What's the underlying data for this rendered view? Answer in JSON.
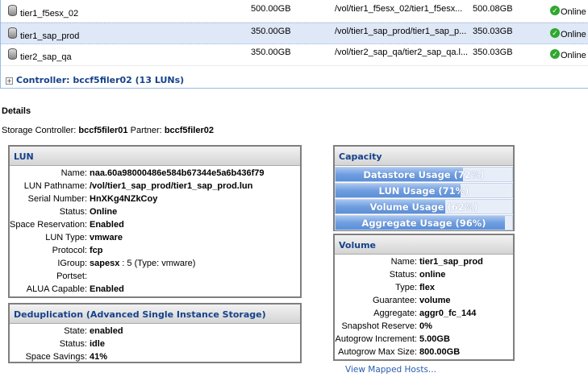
{
  "luns": [
    {
      "name": "tier1_f5esx_02",
      "size": "500.00GB",
      "path": "/vol/tier1_f5esx_02/tier1_f5esx...",
      "alloc": "500.08GB",
      "status": "Online"
    },
    {
      "name": "tier1_sap_prod",
      "size": "350.00GB",
      "path": "/vol/tier1_sap_prod/tier1_sap_p...",
      "alloc": "350.03GB",
      "status": "Online"
    },
    {
      "name": "tier2_sap_qa",
      "size": "350.00GB",
      "path": "/vol/tier2_sap_qa/tier2_sap_qa.l...",
      "alloc": "350.03GB",
      "status": "Online"
    }
  ],
  "controller_group": "Controller: bccf5filer02 (13 LUNs)",
  "details_title": "Details",
  "storage": {
    "label": "Storage Controller:",
    "controller": "bccf5filer01",
    "partner_label": "Partner:",
    "partner": "bccf5filer02"
  },
  "lun_panel": {
    "title": "LUN",
    "fields": [
      {
        "k": "Name:",
        "v": "naa.60a98000486e584b67344e5a6b436f79"
      },
      {
        "k": "LUN Pathname:",
        "v": "/vol/tier1_sap_prod/tier1_sap_prod.lun"
      },
      {
        "k": "Serial Number:",
        "v": "HnXKg4NZkCoy"
      },
      {
        "k": "Status:",
        "v": "Online"
      },
      {
        "k": "Space Reservation:",
        "v": "Enabled"
      },
      {
        "k": "LUN Type:",
        "v": "vmware"
      },
      {
        "k": "Protocol:",
        "v": "fcp"
      },
      {
        "k": "IGroup:",
        "v": "sapesx",
        "v2": ": 5 (Type: vmware)"
      },
      {
        "k": "Portset:",
        "v": ""
      },
      {
        "k": "ALUA Capable:",
        "v": "Enabled"
      }
    ]
  },
  "dedup_panel": {
    "title": "Deduplication (Advanced Single Instance Storage)",
    "fields": [
      {
        "k": "State:",
        "v": "enabled"
      },
      {
        "k": "Status:",
        "v": "idle"
      },
      {
        "k": "Space Savings:",
        "v": "41%"
      }
    ]
  },
  "capacity_panel": {
    "title": "Capacity",
    "bars": [
      {
        "label": "Datastore Usage (72%)",
        "percent": 72
      },
      {
        "label": "LUN Usage (71%)",
        "percent": 71
      },
      {
        "label": "Volume Usage (62%)",
        "percent": 62
      },
      {
        "label": "Aggregate Usage (96%)",
        "percent": 96
      }
    ]
  },
  "volume_panel": {
    "title": "Volume",
    "fields": [
      {
        "k": "Name:",
        "v": "tier1_sap_prod"
      },
      {
        "k": "Status:",
        "v": "online"
      },
      {
        "k": "Type:",
        "v": "flex"
      },
      {
        "k": "Guarantee:",
        "v": "volume"
      },
      {
        "k": "Aggregate:",
        "v": "aggr0_fc_144"
      },
      {
        "k": "Snapshot Reserve:",
        "v": "0%"
      },
      {
        "k": "Autogrow Increment:",
        "v": "5.00GB"
      },
      {
        "k": "Autogrow Max Size:",
        "v": "800.00GB"
      }
    ]
  },
  "view_hosts_link": "View Mapped Hosts..."
}
